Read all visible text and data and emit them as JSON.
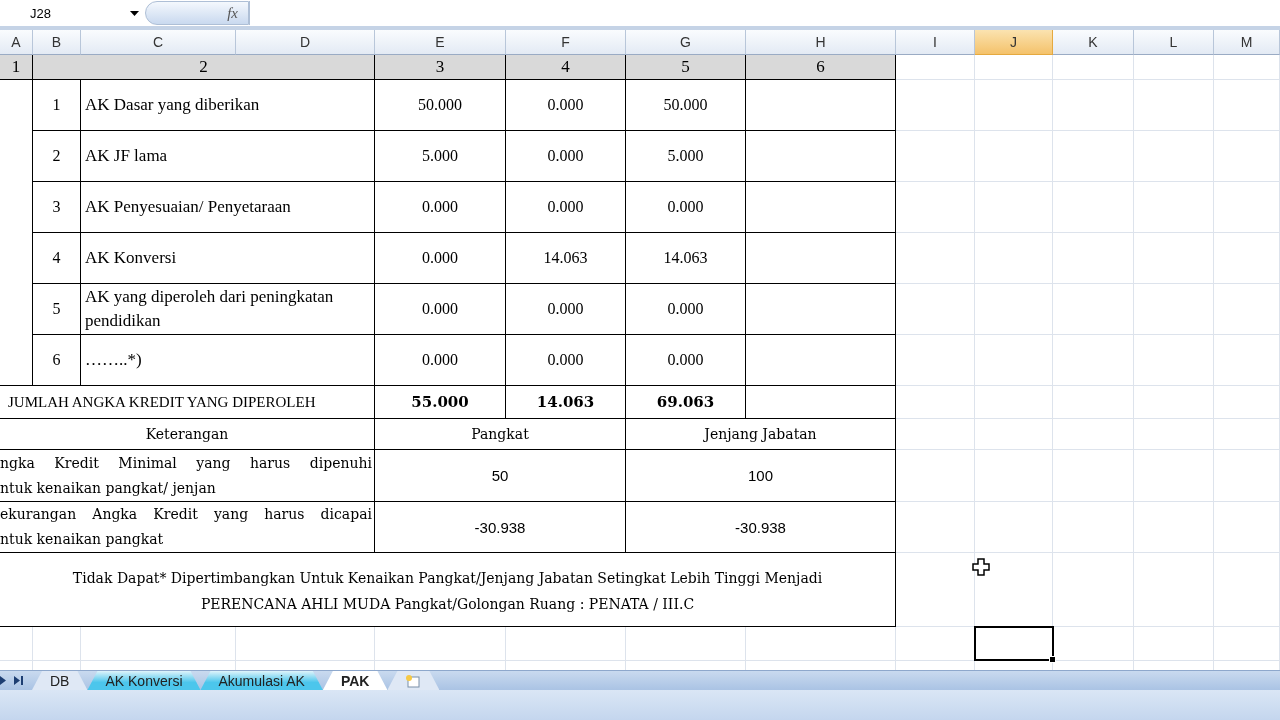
{
  "name_box": "J28",
  "function_label": "fx",
  "columns": [
    {
      "label": "A",
      "selected": false
    },
    {
      "label": "B",
      "selected": false
    },
    {
      "label": "C",
      "selected": false
    },
    {
      "label": "D",
      "selected": false
    },
    {
      "label": "E",
      "selected": false
    },
    {
      "label": "F",
      "selected": false
    },
    {
      "label": "G",
      "selected": false
    },
    {
      "label": "H",
      "selected": false
    },
    {
      "label": "I",
      "selected": false
    },
    {
      "label": "J",
      "selected": true
    },
    {
      "label": "K",
      "selected": false
    },
    {
      "label": "L",
      "selected": false
    },
    {
      "label": "M",
      "selected": false
    }
  ],
  "header_row": [
    "1",
    "2",
    "3",
    "4",
    "5",
    "6"
  ],
  "items": [
    {
      "no": "1",
      "label": "AK Dasar yang diberikan",
      "values": [
        "50.000",
        "0.000",
        "50.000"
      ]
    },
    {
      "no": "2",
      "label": "AK JF lama",
      "values": [
        "5.000",
        "0.000",
        "5.000"
      ]
    },
    {
      "no": "3",
      "label": "AK Penyesuaian/ Penyetaraan",
      "values": [
        "0.000",
        "0.000",
        "0.000"
      ]
    },
    {
      "no": "4",
      "label": "AK Konversi",
      "values": [
        "0.000",
        "14.063",
        "14.063"
      ]
    },
    {
      "no": "5",
      "label": "AK yang diperoleh dari peningkatan pendidikan",
      "values": [
        "0.000",
        "0.000",
        "0.000"
      ]
    },
    {
      "no": "6",
      "label": "……..*)",
      "values": [
        "0.000",
        "0.000",
        "0.000"
      ]
    }
  ],
  "total": {
    "label": "JUMLAH ANGKA KREDIT YANG DIPEROLEH",
    "values": [
      "55.000",
      "14.063",
      "69.063"
    ]
  },
  "summary": {
    "headers": [
      "Keterangan",
      "Pangkat",
      "Jenjang Jabatan"
    ],
    "rows": [
      {
        "lines": [
          "ngka Kredit Minimal yang harus dipenuhi",
          "ntuk kenaikan pangkat/ jenjan"
        ],
        "values": [
          "50",
          "100"
        ]
      },
      {
        "lines": [
          "ekurangan Angka Kredit yang harus dicapai",
          "ntuk kenaikan pangkat"
        ],
        "values": [
          "-30.938",
          "-30.938"
        ]
      }
    ]
  },
  "note": [
    "Tidak Dapat* Dipertimbangkan Untuk Kenaikan Pangkat/Jenjang Jabatan Setingkat Lebih Tinggi Menjadi",
    "PERENCANA AHLI MUDA Pangkat/Golongan Ruang : PENATA / III.C"
  ],
  "sheet_tabs": [
    {
      "label": "DB",
      "selected": false
    },
    {
      "label": "AK Konversi",
      "selected": false,
      "color": "#4cc6ec"
    },
    {
      "label": "Akumulasi AK",
      "selected": false,
      "color": "#4cc6ec"
    },
    {
      "label": "PAK",
      "selected": true
    }
  ]
}
